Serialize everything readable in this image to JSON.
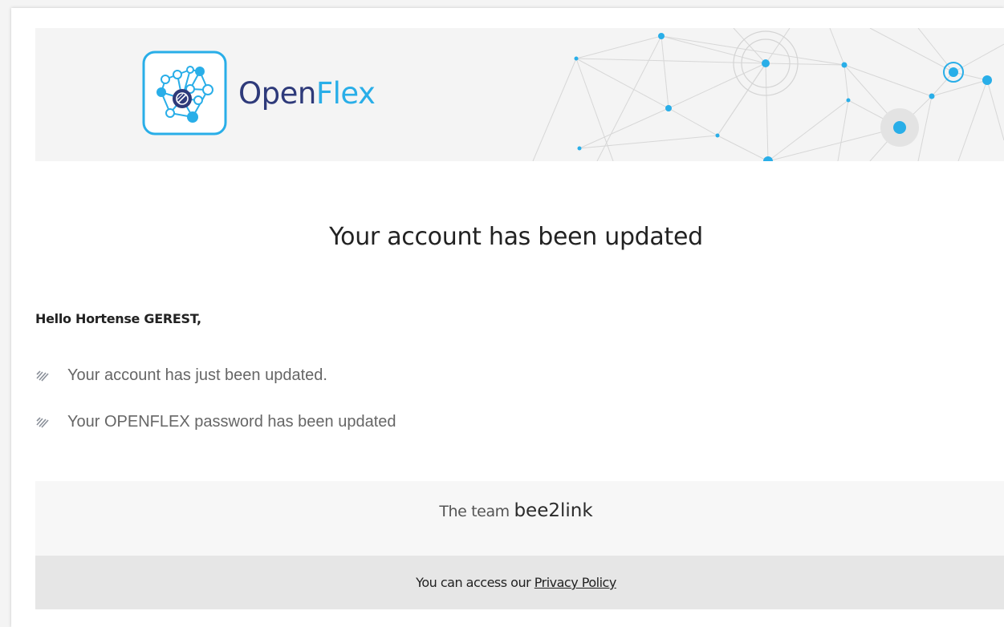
{
  "header": {
    "brand_part1": "Open",
    "brand_part2": "Flex",
    "brand_color_dark": "#2e3a7a",
    "brand_color_light": "#29aee8",
    "logo_icon": "network-molecule-icon"
  },
  "main": {
    "title": "Your account has been updated",
    "greeting": "Hello Hortense GEREST,",
    "items": [
      {
        "text": "Your account has just been updated.",
        "icon": "striped-bullet-icon"
      },
      {
        "text": "Your OPENFLEX password has been updated",
        "icon": "striped-bullet-icon"
      }
    ]
  },
  "footer": {
    "team_prefix": "The team",
    "team_brand": "bee2link",
    "privacy_prefix": "You can access our",
    "privacy_link": "Privacy Policy"
  }
}
